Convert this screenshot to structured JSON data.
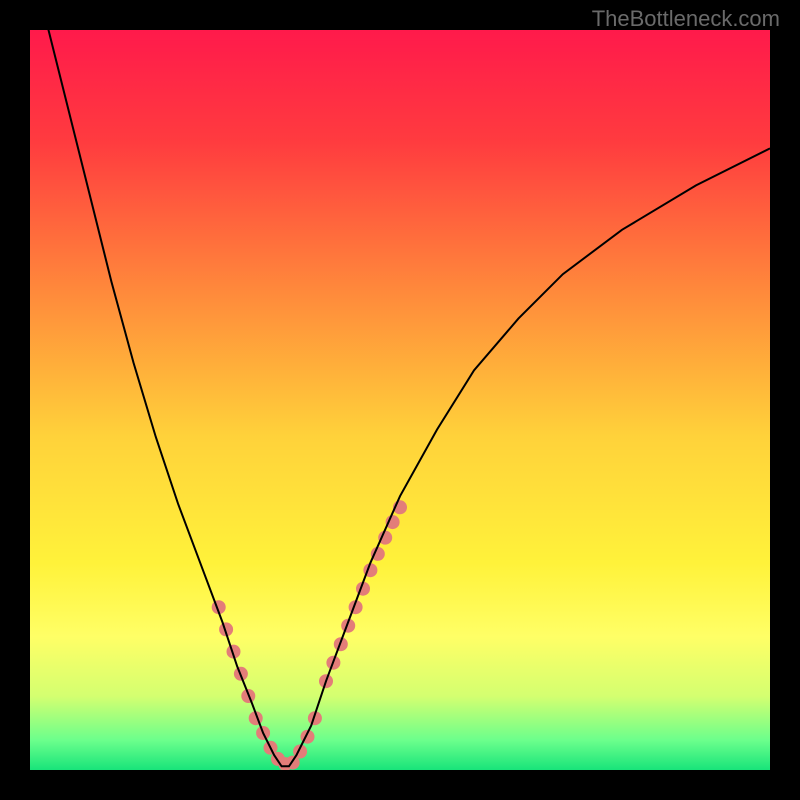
{
  "watermark": "TheBottleneck.com",
  "chart_data": {
    "type": "line",
    "title": "",
    "xlabel": "",
    "ylabel": "",
    "xlim": [
      0,
      100
    ],
    "ylim": [
      0,
      100
    ],
    "background_gradient": {
      "stops": [
        {
          "offset": 0.0,
          "color": "#ff1a4b"
        },
        {
          "offset": 0.15,
          "color": "#ff3b3f"
        },
        {
          "offset": 0.35,
          "color": "#ff883b"
        },
        {
          "offset": 0.55,
          "color": "#ffd23a"
        },
        {
          "offset": 0.72,
          "color": "#fff23a"
        },
        {
          "offset": 0.82,
          "color": "#ffff66"
        },
        {
          "offset": 0.9,
          "color": "#d4ff70"
        },
        {
          "offset": 0.96,
          "color": "#6bff8c"
        },
        {
          "offset": 1.0,
          "color": "#18e47a"
        }
      ]
    },
    "series": [
      {
        "name": "curve",
        "type": "line",
        "stroke": "#000000",
        "stroke_width": 2,
        "x": [
          2,
          5,
          8,
          11,
          14,
          17,
          20,
          23,
          26,
          28,
          30,
          31.5,
          33,
          34,
          35,
          36,
          38,
          40,
          43,
          46,
          50,
          55,
          60,
          66,
          72,
          80,
          90,
          100
        ],
        "y": [
          102,
          90,
          78,
          66,
          55,
          45,
          36,
          28,
          20,
          14,
          9,
          5,
          2,
          0.5,
          0.5,
          2,
          6,
          12,
          20,
          28,
          37,
          46,
          54,
          61,
          67,
          73,
          79,
          84
        ]
      },
      {
        "name": "markers",
        "type": "scatter",
        "color": "#e37d79",
        "radius": 7,
        "x": [
          25.5,
          26.5,
          27.5,
          28.5,
          29.5,
          30.5,
          31.5,
          32.5,
          33.5,
          34.5,
          35.5,
          36.5,
          37.5,
          38.5,
          40,
          41,
          42,
          43,
          44,
          45,
          46,
          47,
          48,
          49,
          50
        ],
        "y": [
          22,
          19,
          16,
          13,
          10,
          7,
          5,
          3,
          1.5,
          0.8,
          1.0,
          2.5,
          4.5,
          7,
          12,
          14.5,
          17,
          19.5,
          22,
          24.5,
          27,
          29.2,
          31.4,
          33.5,
          35.5
        ]
      }
    ]
  }
}
